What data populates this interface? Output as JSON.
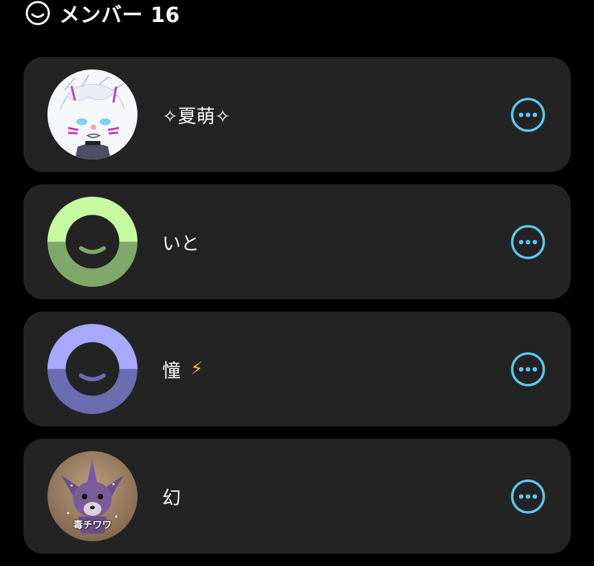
{
  "header": {
    "icon": "smile-face-icon",
    "title": "メンバー 16"
  },
  "members": [
    {
      "name": "✧夏萌✧",
      "avatar": "drawn-character-avatar",
      "extra": ""
    },
    {
      "name": "いと",
      "avatar": "default-face-avatar",
      "avatar_color_top": "#c7f9a0",
      "avatar_color_bottom": "#7fa86a",
      "extra": ""
    },
    {
      "name": "憧",
      "avatar": "default-face-avatar",
      "avatar_color_top": "#a8a8ff",
      "avatar_color_bottom": "#6c6cb0",
      "extra": "⚡"
    },
    {
      "name": "幻",
      "avatar": "photo-avatar",
      "avatar_caption": "毒チワワ",
      "extra": ""
    }
  ],
  "colors": {
    "accent": "#5ec8f2",
    "card": "#232323",
    "background": "#000000"
  }
}
